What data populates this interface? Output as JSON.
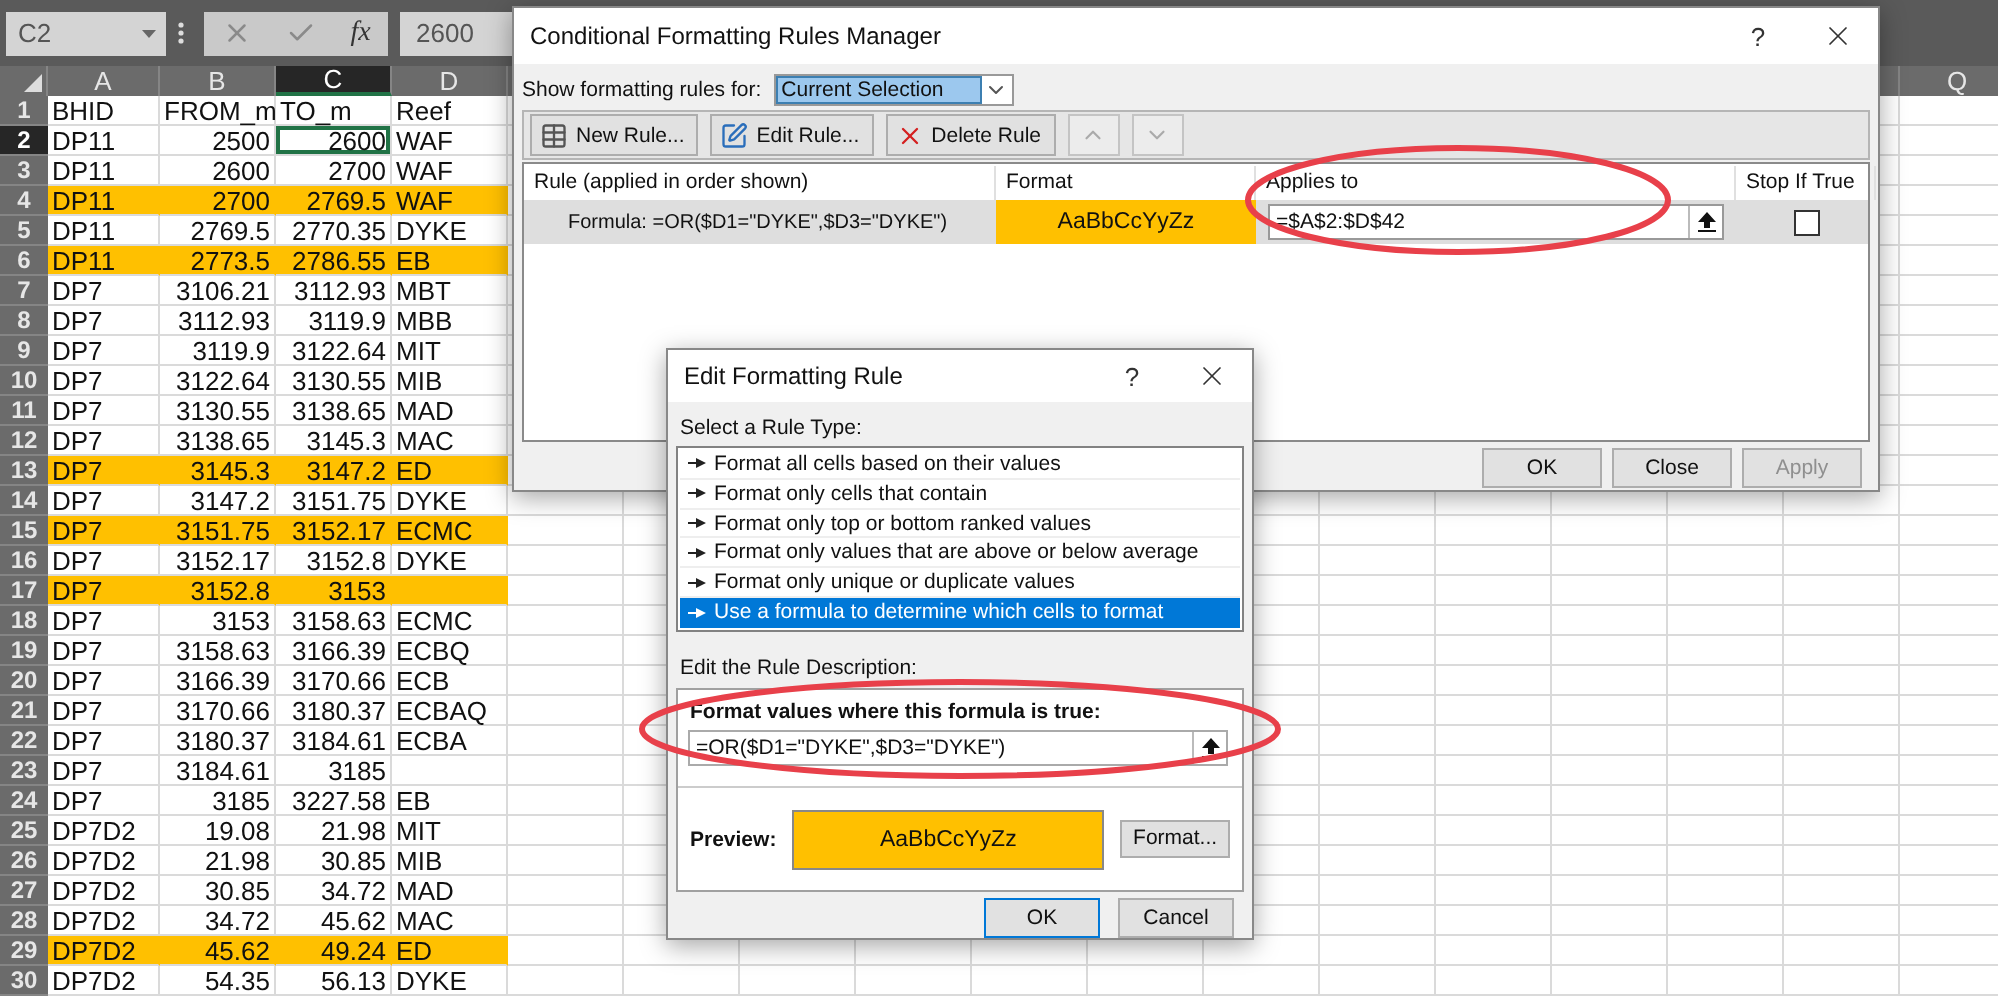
{
  "formula_bar": {
    "name_box": "C2",
    "function_label": "fx",
    "formula": "2600"
  },
  "sheet": {
    "columns": [
      {
        "label": "A",
        "selected": false,
        "numeric": false
      },
      {
        "label": "B",
        "selected": false,
        "numeric": true
      },
      {
        "label": "C",
        "selected": true,
        "numeric": true
      },
      {
        "label": "D",
        "selected": false,
        "numeric": false
      },
      {
        "label": "Q",
        "selected": false
      }
    ],
    "rows": [
      {
        "number": "1",
        "selected": false,
        "highlighted": false,
        "kind": "labels",
        "cells": [
          "BHID",
          "FROM_m",
          "TO_m",
          "Reef"
        ]
      },
      {
        "number": "2",
        "selected": true,
        "highlighted": false,
        "kind": "values",
        "cells": [
          "DP11",
          "2500",
          "2600",
          "WAF"
        ]
      },
      {
        "number": "3",
        "selected": false,
        "highlighted": false,
        "kind": "values",
        "cells": [
          "DP11",
          "2600",
          "2700",
          "WAF"
        ]
      },
      {
        "number": "4",
        "selected": false,
        "highlighted": true,
        "kind": "values",
        "cells": [
          "DP11",
          "2700",
          "2769.5",
          "WAF"
        ]
      },
      {
        "number": "5",
        "selected": false,
        "highlighted": false,
        "kind": "values",
        "cells": [
          "DP11",
          "2769.5",
          "2770.35",
          "DYKE"
        ]
      },
      {
        "number": "6",
        "selected": false,
        "highlighted": true,
        "kind": "values",
        "cells": [
          "DP11",
          "2773.5",
          "2786.55",
          "EB"
        ]
      },
      {
        "number": "7",
        "selected": false,
        "highlighted": false,
        "kind": "values",
        "cells": [
          "DP7",
          "3106.21",
          "3112.93",
          "MBT"
        ]
      },
      {
        "number": "8",
        "selected": false,
        "highlighted": false,
        "kind": "values",
        "cells": [
          "DP7",
          "3112.93",
          "3119.9",
          "MBB"
        ]
      },
      {
        "number": "9",
        "selected": false,
        "highlighted": false,
        "kind": "values",
        "cells": [
          "DP7",
          "3119.9",
          "3122.64",
          "MIT"
        ]
      },
      {
        "number": "10",
        "selected": false,
        "highlighted": false,
        "kind": "values",
        "cells": [
          "DP7",
          "3122.64",
          "3130.55",
          "MIB"
        ]
      },
      {
        "number": "11",
        "selected": false,
        "highlighted": false,
        "kind": "values",
        "cells": [
          "DP7",
          "3130.55",
          "3138.65",
          "MAD"
        ]
      },
      {
        "number": "12",
        "selected": false,
        "highlighted": false,
        "kind": "values",
        "cells": [
          "DP7",
          "3138.65",
          "3145.3",
          "MAC"
        ]
      },
      {
        "number": "13",
        "selected": false,
        "highlighted": true,
        "kind": "values",
        "cells": [
          "DP7",
          "3145.3",
          "3147.2",
          "ED"
        ]
      },
      {
        "number": "14",
        "selected": false,
        "highlighted": false,
        "kind": "values",
        "cells": [
          "DP7",
          "3147.2",
          "3151.75",
          "DYKE"
        ]
      },
      {
        "number": "15",
        "selected": false,
        "highlighted": true,
        "kind": "values",
        "cells": [
          "DP7",
          "3151.75",
          "3152.17",
          "ECMC"
        ]
      },
      {
        "number": "16",
        "selected": false,
        "highlighted": false,
        "kind": "values",
        "cells": [
          "DP7",
          "3152.17",
          "3152.8",
          "DYKE"
        ]
      },
      {
        "number": "17",
        "selected": false,
        "highlighted": true,
        "kind": "values",
        "cells": [
          "DP7",
          "3152.8",
          "3153"
        ]
      },
      {
        "number": "18",
        "selected": false,
        "highlighted": false,
        "kind": "values",
        "cells": [
          "DP7",
          "3153",
          "3158.63",
          "ECMC"
        ]
      },
      {
        "number": "19",
        "selected": false,
        "highlighted": false,
        "kind": "values",
        "cells": [
          "DP7",
          "3158.63",
          "3166.39",
          "ECBQ"
        ]
      },
      {
        "number": "20",
        "selected": false,
        "highlighted": false,
        "kind": "values",
        "cells": [
          "DP7",
          "3166.39",
          "3170.66",
          "ECB"
        ]
      },
      {
        "number": "21",
        "selected": false,
        "highlighted": false,
        "kind": "values",
        "cells": [
          "DP7",
          "3170.66",
          "3180.37",
          "ECBAQ"
        ]
      },
      {
        "number": "22",
        "selected": false,
        "highlighted": false,
        "kind": "values",
        "cells": [
          "DP7",
          "3180.37",
          "3184.61",
          "ECBA"
        ]
      },
      {
        "number": "23",
        "selected": false,
        "highlighted": false,
        "kind": "values",
        "cells": [
          "DP7",
          "3184.61",
          "3185"
        ]
      },
      {
        "number": "24",
        "selected": false,
        "highlighted": false,
        "kind": "values",
        "cells": [
          "DP7",
          "3185",
          "3227.58",
          "EB"
        ]
      },
      {
        "number": "25",
        "selected": false,
        "highlighted": false,
        "kind": "values",
        "cells": [
          "DP7D2",
          "19.08",
          "21.98",
          "MIT"
        ]
      },
      {
        "number": "26",
        "selected": false,
        "highlighted": false,
        "kind": "values",
        "cells": [
          "DP7D2",
          "21.98",
          "30.85",
          "MIB"
        ]
      },
      {
        "number": "27",
        "selected": false,
        "highlighted": false,
        "kind": "values",
        "cells": [
          "DP7D2",
          "30.85",
          "34.72",
          "MAD"
        ]
      },
      {
        "number": "28",
        "selected": false,
        "highlighted": false,
        "kind": "values",
        "cells": [
          "DP7D2",
          "34.72",
          "45.62",
          "MAC"
        ]
      },
      {
        "number": "29",
        "selected": false,
        "highlighted": true,
        "kind": "values",
        "cells": [
          "DP7D2",
          "45.62",
          "49.24",
          "ED"
        ]
      },
      {
        "number": "30",
        "selected": false,
        "highlighted": false,
        "kind": "values",
        "cells": [
          "DP7D2",
          "54.35",
          "56.13",
          "DYKE"
        ]
      }
    ]
  },
  "rules_manager": {
    "title": "Conditional Formatting Rules Manager",
    "help": "?",
    "show_label": "Show formatting rules for:",
    "scope": "Current Selection",
    "toolbar": [
      "New Rule...",
      "Edit Rule...",
      "Delete Rule"
    ],
    "columns": [
      "Rule (applied in order shown)",
      "Format",
      "Applies to",
      "Stop If True"
    ],
    "rules": [
      {
        "rule": "Formula: =OR($D1=\"DYKE\",$D3=\"DYKE\")",
        "preview": "AaBbCcYyZz",
        "applies_to": "=$A$2:$D$42",
        "stop_if_true": false,
        "selected": true
      }
    ],
    "buttons": [
      {
        "label": "OK",
        "disabled": false
      },
      {
        "label": "Close",
        "disabled": false
      },
      {
        "label": "Apply",
        "disabled": true
      }
    ]
  },
  "edit_rule": {
    "title": "Edit Formatting Rule",
    "help": "?",
    "select_label": "Select a Rule Type:",
    "rule_types": [
      {
        "label": "Format all cells based on their values",
        "selected": false
      },
      {
        "label": "Format only cells that contain",
        "selected": false
      },
      {
        "label": "Format only top or bottom ranked values",
        "selected": false
      },
      {
        "label": "Format only values that are above or below average",
        "selected": false
      },
      {
        "label": "Format only unique or duplicate values",
        "selected": false
      },
      {
        "label": "Use a formula to determine which cells to format",
        "selected": true
      }
    ],
    "description_label": "Edit the Rule Description:",
    "formula_label": "Format values where this formula is true:",
    "formula": "=OR($D1=\"DYKE\",$D3=\"DYKE\")",
    "preview_label": "Preview:",
    "preview": "AaBbCcYyZz",
    "format_button": "Format...",
    "buttons": [
      {
        "label": "OK",
        "default": true
      },
      {
        "label": "Cancel",
        "default": false
      }
    ]
  }
}
